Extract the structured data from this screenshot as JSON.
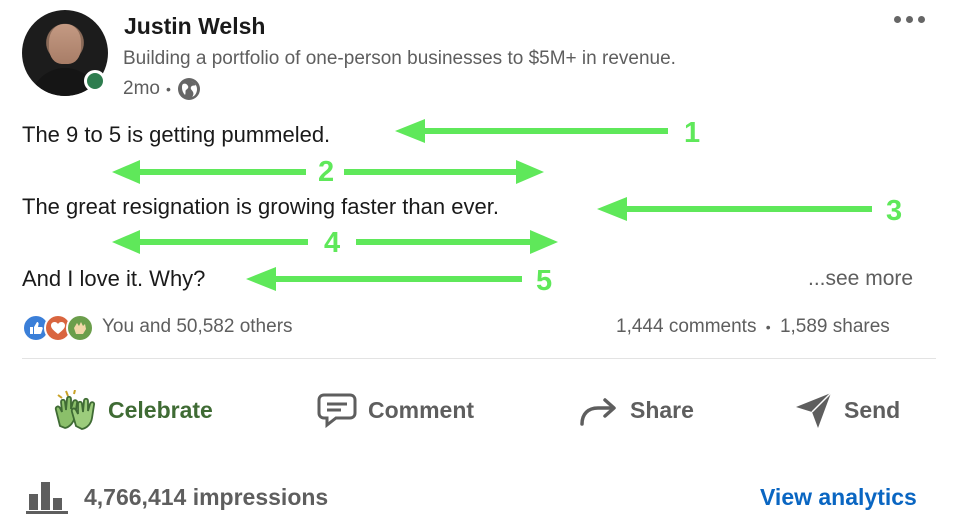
{
  "author": {
    "name": "Justin Welsh",
    "headline": "Building a portfolio of one-person businesses to $5M+ in revenue.",
    "time": "2mo",
    "separator": "•"
  },
  "post": {
    "line1": "The 9 to 5 is getting pummeled.",
    "line3": "The great resignation is growing faster than ever.",
    "line5": "And I love it. Why?",
    "see_more": "...see more"
  },
  "annotations": {
    "color": "#5fe85a",
    "numbers": [
      "1",
      "2",
      "3",
      "4",
      "5"
    ]
  },
  "social": {
    "reactions_text": "You and 50,582 others",
    "comments": "1,444 comments",
    "dot": "•",
    "shares": "1,589 shares"
  },
  "actions": {
    "celebrate": "Celebrate",
    "comment": "Comment",
    "share": "Share",
    "send": "Send"
  },
  "footer": {
    "impressions": "4,766,414 impressions",
    "analytics": "View analytics"
  },
  "colors": {
    "accent_link": "#0a66c2",
    "celebrate_green": "#3f6b34",
    "muted_text": "#5e5e5e"
  },
  "icons": [
    "more-options-icon",
    "globe-icon",
    "like-reaction-icon",
    "love-reaction-icon",
    "celebrate-reaction-icon",
    "celebrate-icon",
    "comment-icon",
    "share-icon",
    "send-icon",
    "analytics-bar-icon"
  ]
}
